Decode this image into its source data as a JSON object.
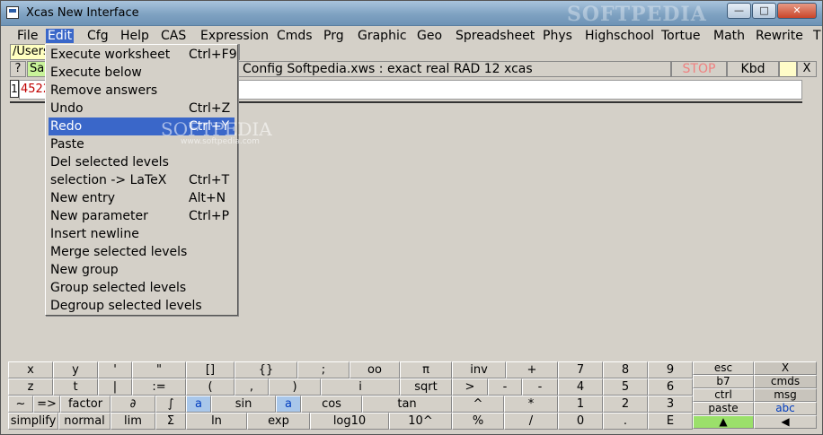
{
  "window": {
    "title": "Xcas New Interface",
    "watermark": "SOFTPEDIA",
    "minimize": "—",
    "maximize": "□",
    "close": "✕"
  },
  "menubar": {
    "items": [
      "File",
      "Edit",
      "Cfg",
      "Help",
      "CAS",
      "Expression",
      "Cmds",
      "Prg",
      "Graphic",
      "Geo",
      "Spreadsheet",
      "Phys",
      "Highschool",
      "Tortue",
      "Math",
      "Rewrite",
      "T"
    ]
  },
  "toolbar": {
    "path": "/Users",
    "help": "?",
    "save": "Sa",
    "config": "Config Softpedia.xws : exact real RAD 12 xcas",
    "stop": "STOP",
    "kbd": "Kbd",
    "close": "X"
  },
  "worksheet": {
    "entry_number": "1",
    "entry_value": "4522"
  },
  "edit_menu": {
    "items": [
      {
        "label": "Execute worksheet",
        "shortcut": "Ctrl+F9"
      },
      {
        "label": "Execute below",
        "shortcut": ""
      },
      {
        "label": "Remove answers",
        "shortcut": ""
      },
      {
        "label": "Undo",
        "shortcut": "Ctrl+Z"
      },
      {
        "label": "Redo",
        "shortcut": "Ctrl+Y"
      },
      {
        "label": "Paste",
        "shortcut": ""
      },
      {
        "label": "Del selected levels",
        "shortcut": ""
      },
      {
        "label": "selection -> LaTeX",
        "shortcut": "Ctrl+T"
      },
      {
        "label": "New entry",
        "shortcut": "Alt+N"
      },
      {
        "label": "New parameter",
        "shortcut": "Ctrl+P"
      },
      {
        "label": "Insert newline",
        "shortcut": ""
      },
      {
        "label": "Merge selected levels",
        "shortcut": ""
      },
      {
        "label": "New group",
        "shortcut": ""
      },
      {
        "label": "Group selected levels",
        "shortcut": ""
      },
      {
        "label": "Degroup selected levels",
        "shortcut": ""
      }
    ],
    "highlighted": "Redo",
    "watermark": "SOFTPEDIA",
    "watermark_sub": "www.softpedia.com"
  },
  "keyboard": {
    "row1": [
      "x",
      "y",
      "'",
      "\"",
      "[]",
      "{}",
      ";",
      "oo",
      "π",
      "inv",
      "+",
      "7",
      "8",
      "9",
      "esc",
      "X"
    ],
    "row2": [
      "z",
      "t",
      "|",
      ":=",
      "(",
      ",",
      ")",
      "i",
      "sqrt",
      ">",
      "-",
      "-",
      "4",
      "5",
      "6",
      "b7",
      "cmds"
    ],
    "row3": [
      "~",
      "=>",
      "factor",
      "∂",
      "∫",
      "a",
      "sin",
      "a",
      "cos",
      "tan",
      "^",
      "*",
      "1",
      "2",
      "3",
      "ctrl",
      "msg"
    ],
    "row4": [
      "simplify",
      "normal",
      "lim",
      "Σ",
      "ln",
      "exp",
      "log10",
      "10^",
      "%",
      "/",
      "0",
      ".",
      "E",
      "paste",
      "abc",
      "▲",
      "◀"
    ]
  },
  "colors": {
    "accent": "#3a67c9",
    "entry_text": "#c00000",
    "stop_text": "#f08080",
    "save_bg": "#c9f49a",
    "path_bg": "#ffffc0"
  }
}
